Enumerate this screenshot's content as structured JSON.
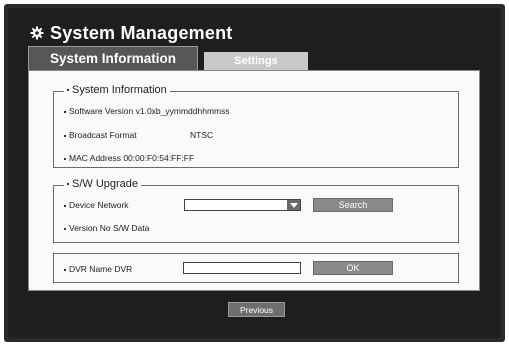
{
  "window": {
    "title": "System Management",
    "icon": "gear-icon"
  },
  "tabs": [
    {
      "label": "System Information",
      "active": true
    },
    {
      "label": "Settings",
      "active": false
    }
  ],
  "system_information": {
    "legend": "System Information",
    "software_version": "Software Version  v1.0xb_yymmddhhmmss",
    "broadcast_format_label": "Broadcast Format",
    "broadcast_format_value": "NTSC",
    "mac_address": "MAC Address  00:00:F0:54:FF:FF"
  },
  "sw_upgrade": {
    "legend": "S/W Upgrade",
    "device_label": "Device  Network",
    "device_value": "",
    "search_label": "Search",
    "version_label": "Version  No S/W Data"
  },
  "dvr": {
    "name_label": "DVR Name  DVR",
    "name_value": "",
    "ok_label": "OK"
  },
  "footer": {
    "previous_label": "Previous"
  }
}
